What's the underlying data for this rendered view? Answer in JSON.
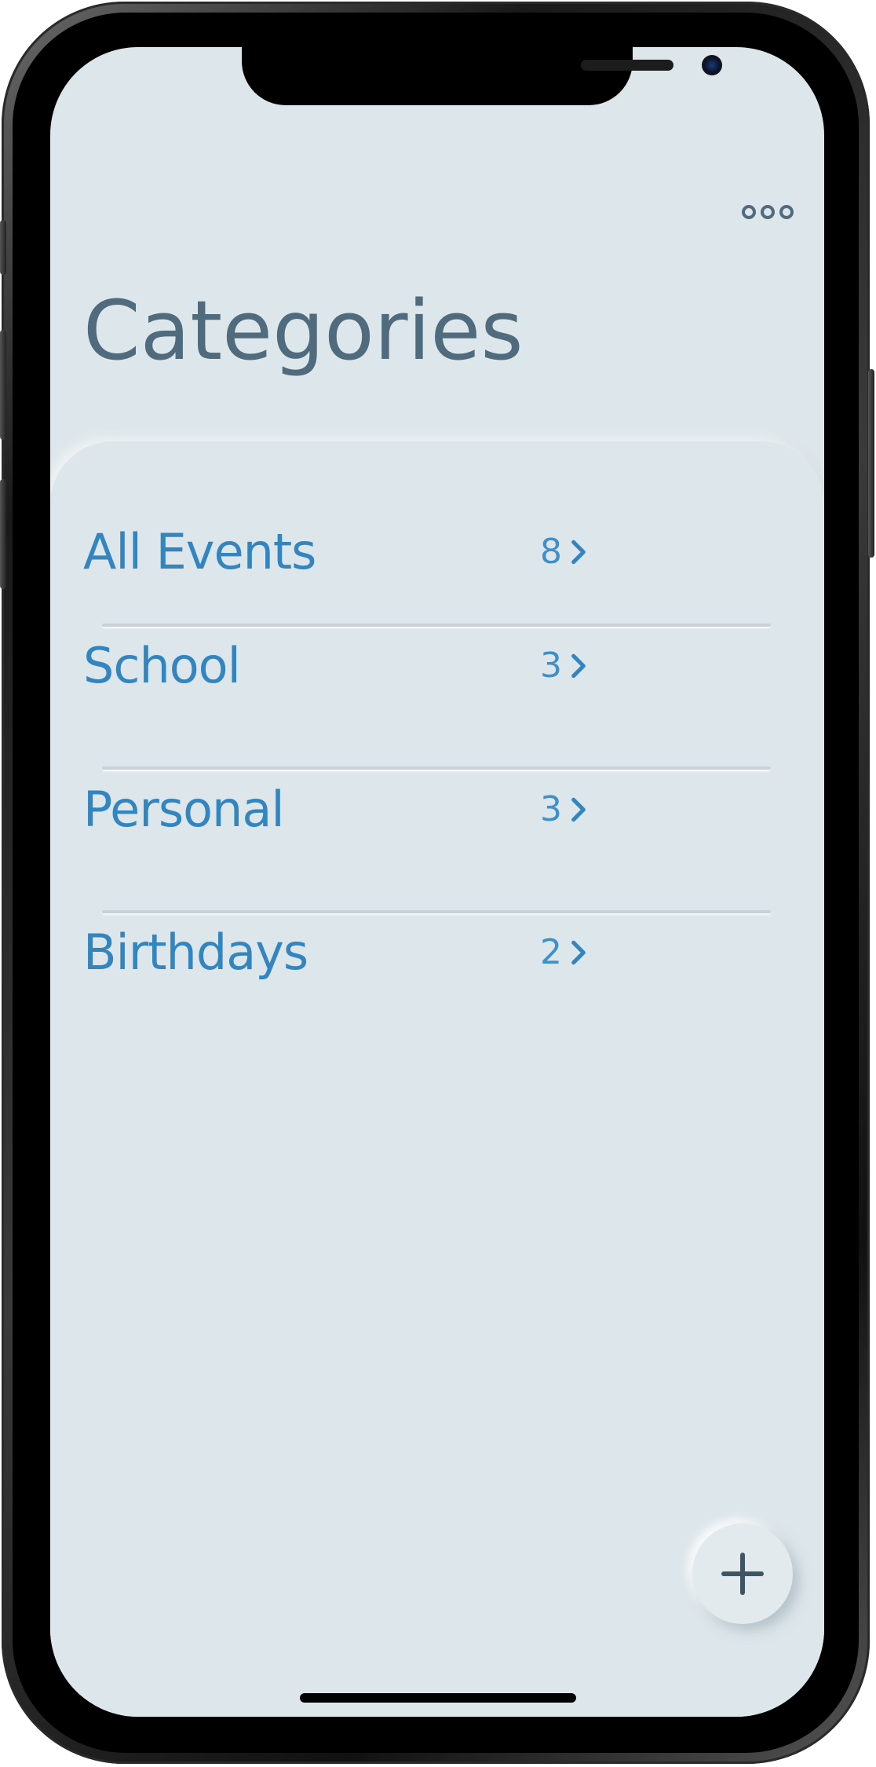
{
  "screen": {
    "background": "#dde6ea",
    "title": "Categories"
  },
  "header": {
    "more_icon": "more-options-icon"
  },
  "categories": [
    {
      "label": "All Events",
      "count": "8"
    },
    {
      "label": "School",
      "count": "3"
    },
    {
      "label": "Personal",
      "count": "3"
    },
    {
      "label": "Birthdays",
      "count": "2"
    }
  ],
  "fab": {
    "icon": "plus-icon"
  },
  "colors": {
    "title": "#4f6b7d",
    "accent": "#3385bf"
  }
}
